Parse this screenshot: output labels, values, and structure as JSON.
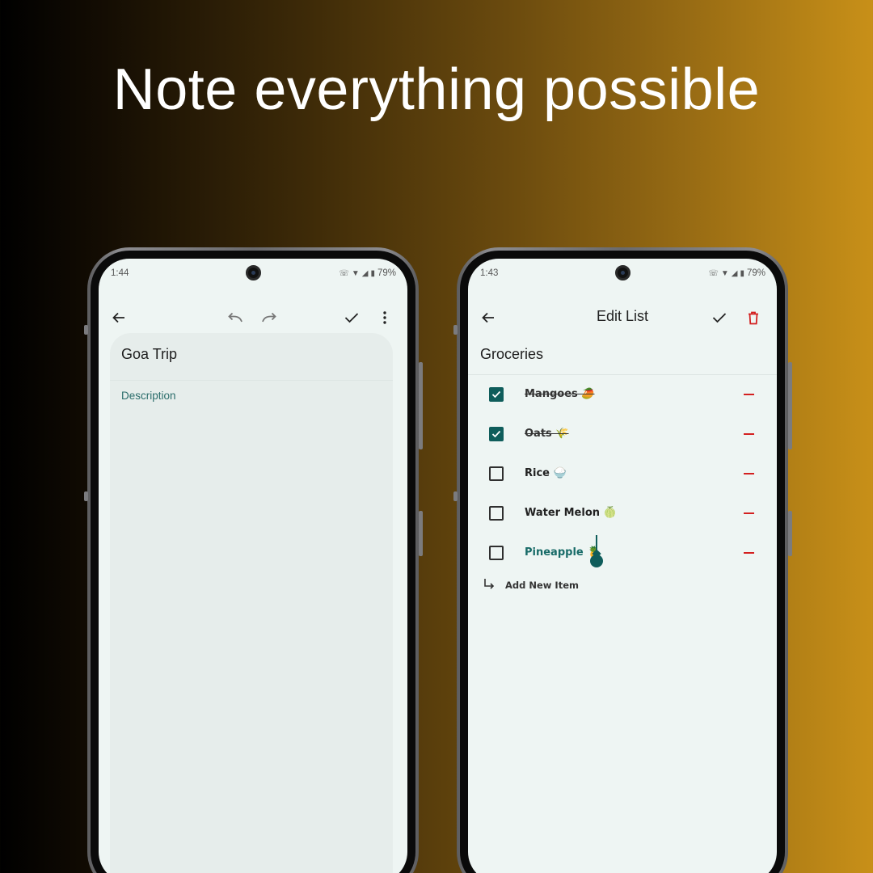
{
  "headline": "Note everything possible",
  "left_phone": {
    "status": {
      "time": "1:44",
      "battery": "79%"
    },
    "toolbar": {
      "back_icon": "arrow-left-icon",
      "undo_icon": "undo-icon",
      "redo_icon": "redo-icon",
      "save_icon": "check-icon",
      "more_icon": "more-vert-icon"
    },
    "note": {
      "title": "Goa Trip",
      "description_placeholder": "Description"
    }
  },
  "right_phone": {
    "status": {
      "time": "1:43",
      "battery": "79%"
    },
    "toolbar": {
      "title": "Edit List",
      "back_icon": "arrow-left-icon",
      "save_icon": "check-icon",
      "delete_icon": "trash-icon"
    },
    "list": {
      "title": "Groceries",
      "items": [
        {
          "label": "Mangoes 🥭",
          "checked": true
        },
        {
          "label": "Oats 🌾",
          "checked": true
        },
        {
          "label": "Rice 🍚",
          "checked": false
        },
        {
          "label": "Water Melon 🍈",
          "checked": false
        },
        {
          "label": "Pineapple 🍍",
          "checked": false
        }
      ],
      "add_label": "Add New Item"
    }
  },
  "colors": {
    "accent": "#0f5d5b",
    "danger": "#d32020",
    "screen_bg": "#eef5f3"
  }
}
